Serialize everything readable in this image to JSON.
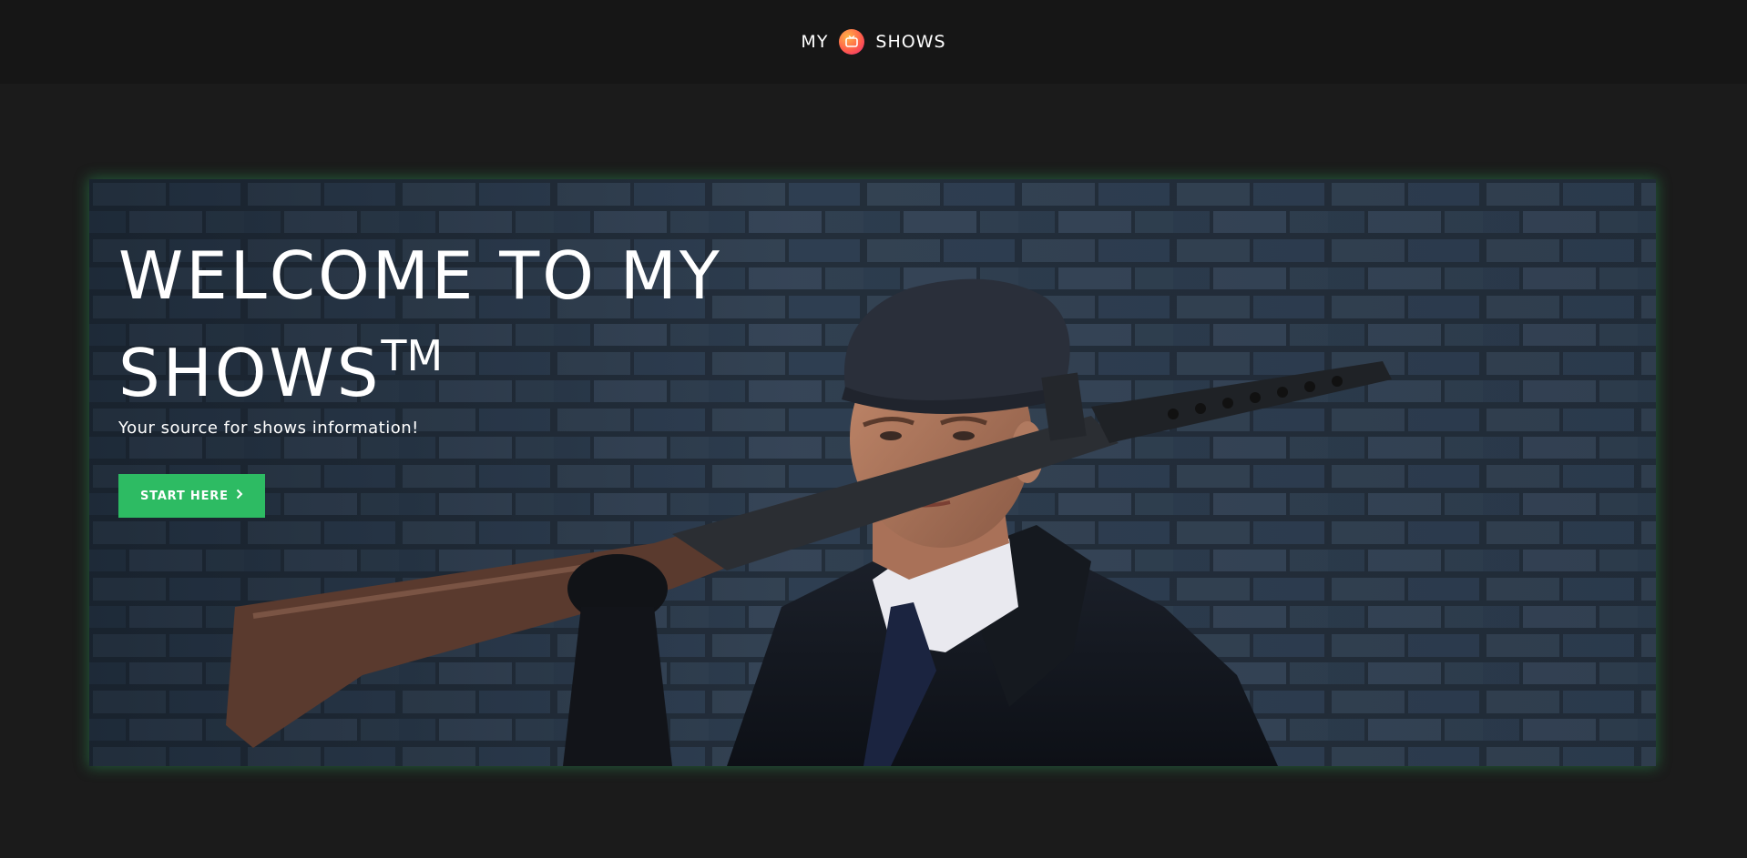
{
  "header": {
    "brand_left": "MY",
    "brand_right": "SHOWS",
    "logo_icon": "tv-icon"
  },
  "hero": {
    "title_line1": "WELCOME TO MY",
    "title_line2": "SHOWS",
    "title_trademark": "TM",
    "subtitle": "Your source for shows information!",
    "cta_label": "START HERE",
    "cta_icon": "chevron-right-icon",
    "background_image": "man-in-flat-cap-with-rifle-against-brick-wall"
  },
  "colors": {
    "page_bg": "#1b1b1b",
    "header_bg": "#161616",
    "accent": "#2dbb63",
    "glow": "#2ea05a"
  }
}
